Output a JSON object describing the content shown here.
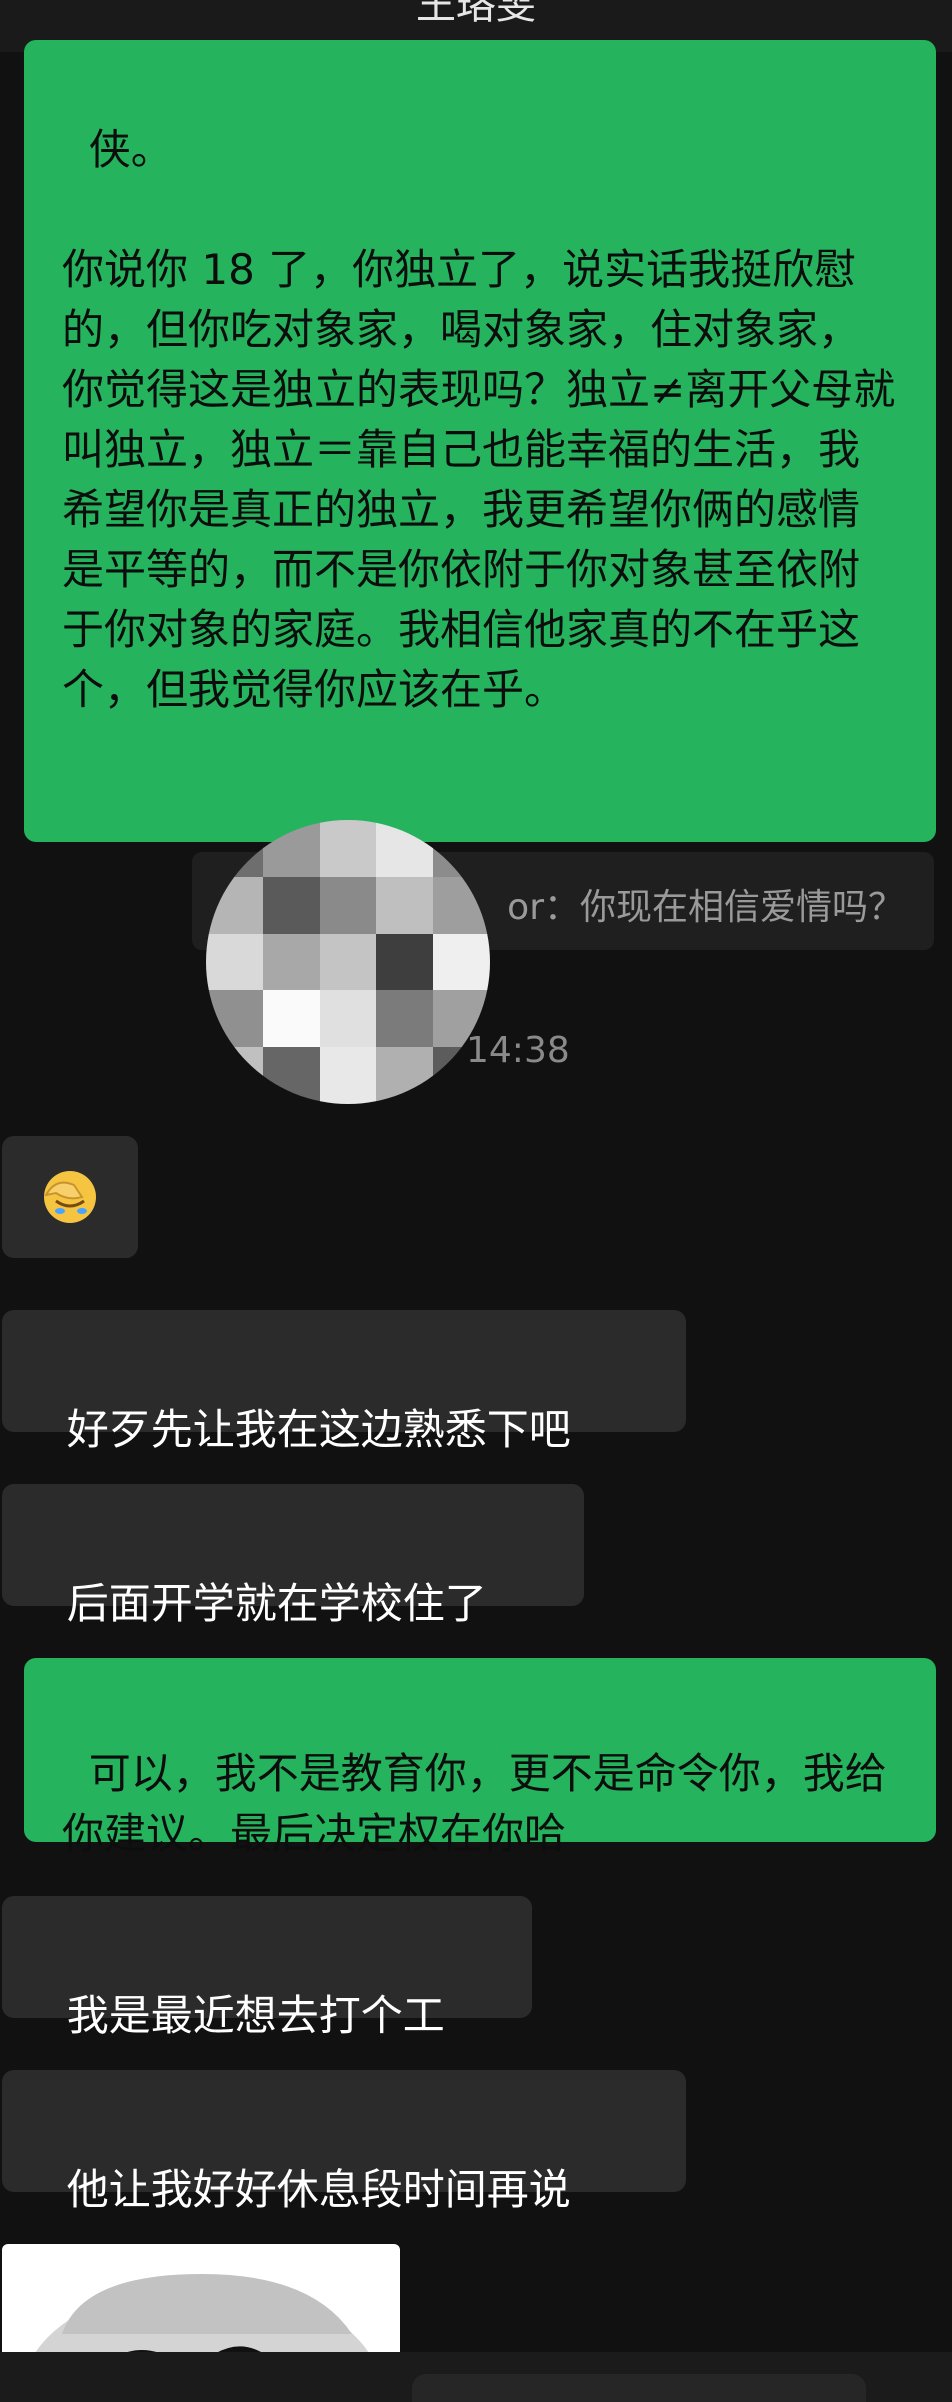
{
  "header": {
    "title": "王珞雯"
  },
  "messages": {
    "m1": "侠。\n\n你说你 18 了，你独立了，说实话我挺欣慰的，但你吃对象家，喝对象家，住对象家，你觉得这是独立的表现吗？独立≠离开父母就叫独立，独立＝靠自己也能幸福的生活，我希望你是真正的独立，我更希望你俩的感情是平等的，而不是你依附于你对象甚至依附于你对象的家庭。我相信他家真的不在乎这个，但我觉得你应该在乎。",
    "quote": "or：你现在相信爱情吗？",
    "time": "14:38",
    "m2_icon": "facepalm-emoji",
    "m3": "好歹先让我在这边熟悉下吧",
    "m4": "后面开学就在学校住了",
    "m5": "可以，我不是教育你，更不是命令你，我给你建议。最后决定权在你哈",
    "m6": "我是最近想去打个工",
    "m7": "他让我好好休息段时间再说"
  },
  "colors": {
    "me_bubble": "#25b35d",
    "other_bubble": "#2b2b2b",
    "background": "#111111"
  }
}
